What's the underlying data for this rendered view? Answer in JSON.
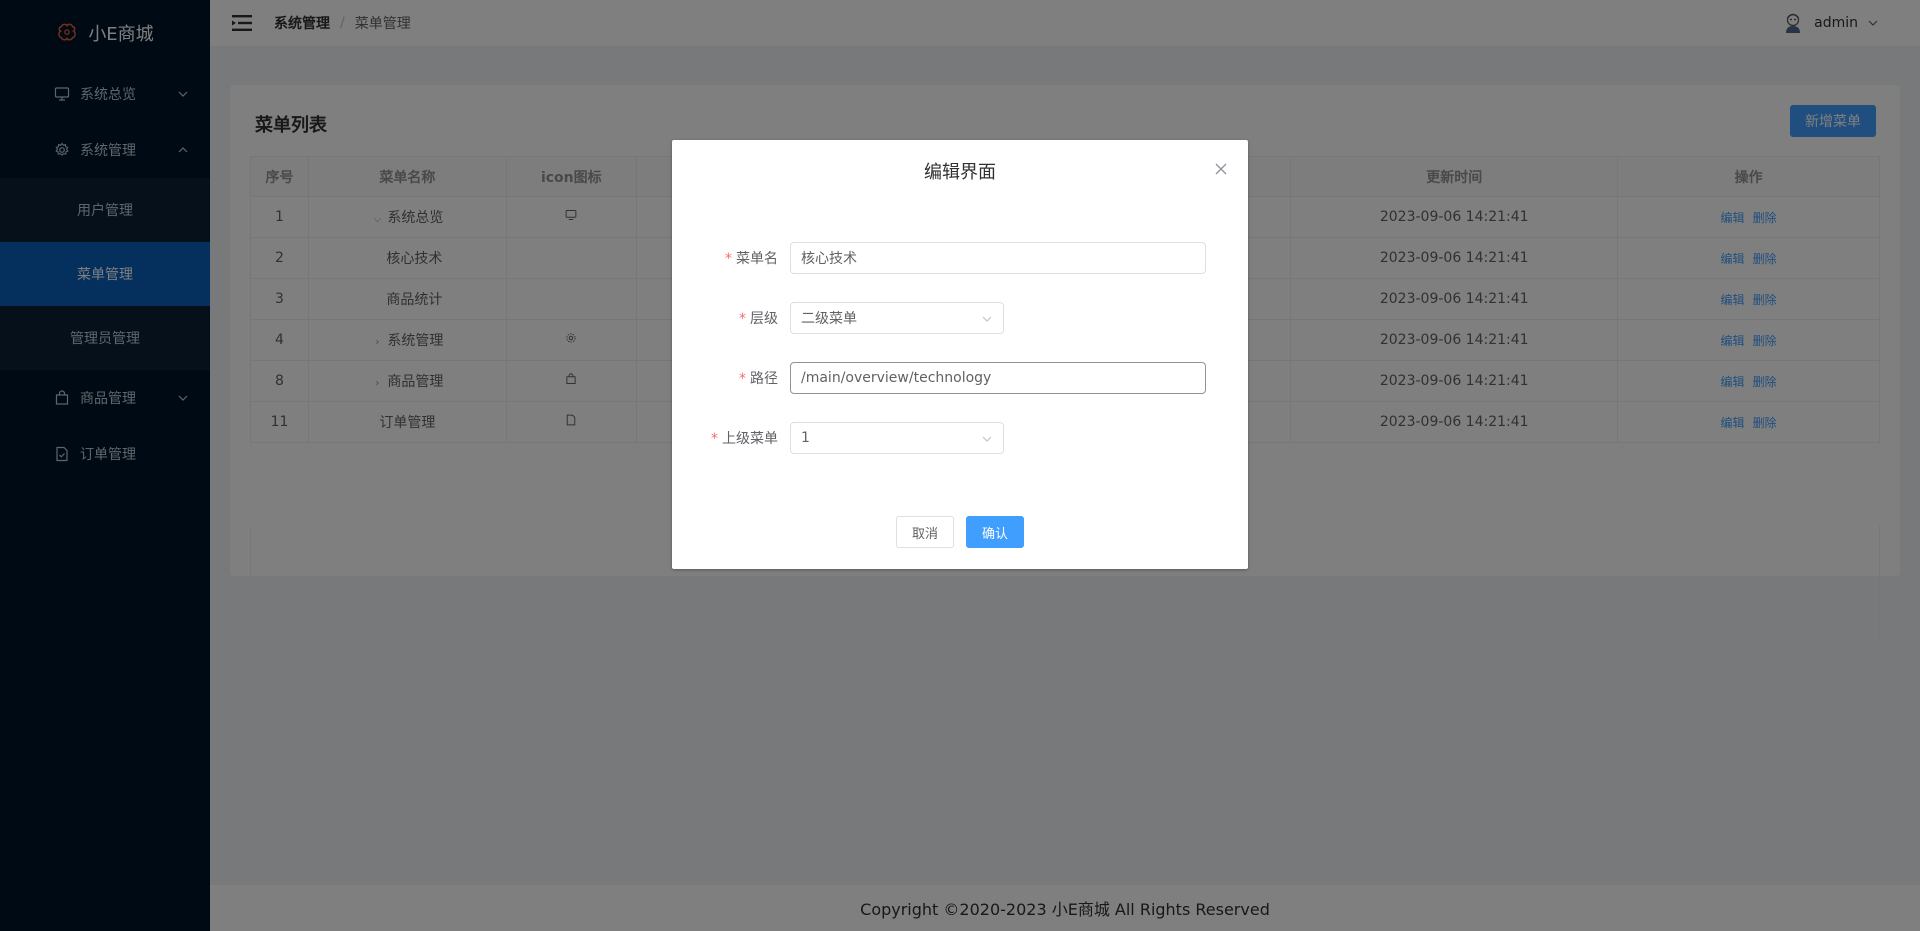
{
  "app": {
    "title": "小E商城",
    "brand_color": "#e8602c"
  },
  "sidebar": {
    "items": [
      {
        "label": "系统总览",
        "icon": "monitor-icon",
        "expanded": false
      },
      {
        "label": "系统管理",
        "icon": "gear-icon",
        "expanded": true
      },
      {
        "label": "商品管理",
        "icon": "bag-icon",
        "expanded": false
      },
      {
        "label": "订单管理",
        "icon": "document-icon"
      }
    ],
    "sub_items": [
      {
        "label": "用户管理"
      },
      {
        "label": "菜单管理",
        "active": true
      },
      {
        "label": "管理员管理"
      }
    ]
  },
  "header": {
    "breadcrumb": [
      "系统管理",
      "菜单管理"
    ],
    "breadcrumb_sep": "/",
    "user": "admin"
  },
  "card": {
    "title": "菜单列表",
    "new_button": "新增菜单",
    "columns": [
      "序号",
      "菜单名称",
      "icon图标",
      "更新时间",
      "操作"
    ],
    "rows": [
      {
        "id": "1",
        "name": "系统总览",
        "tree": "expanded",
        "icon": "monitor-icon",
        "updated": "2023-09-06 14:21:41"
      },
      {
        "id": "2",
        "name": "核心技术",
        "tree": "child",
        "icon": "",
        "updated": "2023-09-06 14:21:41"
      },
      {
        "id": "3",
        "name": "商品统计",
        "tree": "child",
        "icon": "",
        "updated": "2023-09-06 14:21:41"
      },
      {
        "id": "4",
        "name": "系统管理",
        "tree": "collapsed",
        "icon": "gear-icon",
        "updated": "2023-09-06 14:21:41"
      },
      {
        "id": "8",
        "name": "商品管理",
        "tree": "collapsed",
        "icon": "bag-icon",
        "updated": "2023-09-06 14:21:41"
      },
      {
        "id": "11",
        "name": "订单管理",
        "tree": "none",
        "icon": "document-icon",
        "updated": "2023-09-06 14:21:41"
      }
    ],
    "edit_label": "编辑",
    "delete_label": "删除"
  },
  "footer": {
    "text": "Copyright ©2020-2023 小E商城 All Rights Reserved"
  },
  "dialog": {
    "title": "编辑界面",
    "fields": {
      "name": {
        "label": "菜单名",
        "value": "核心技术"
      },
      "level": {
        "label": "层级",
        "value": "二级菜单"
      },
      "path": {
        "label": "路径",
        "value": "/main/overview/technology"
      },
      "parent": {
        "label": "上级菜单",
        "value": "1"
      }
    },
    "required_mark": "*",
    "cancel": "取消",
    "confirm": "确认"
  }
}
